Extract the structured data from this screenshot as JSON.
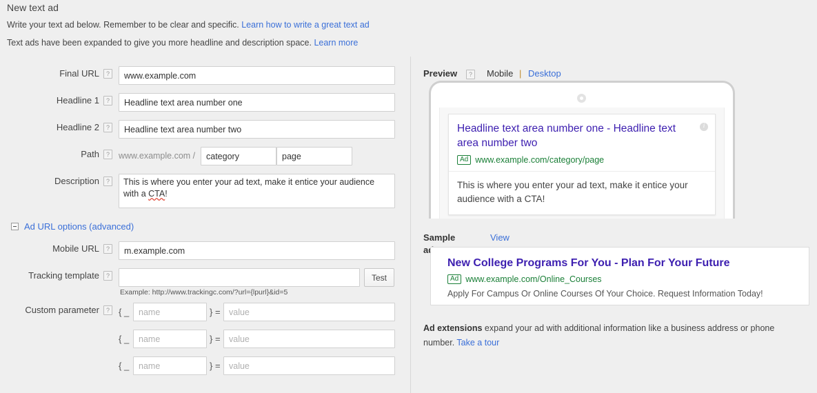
{
  "header": {
    "title": "New text ad",
    "line1_text": "Write your text ad below. Remember to be clear and specific.",
    "line1_link": "Learn how to write a great text ad",
    "line2_text": "Text ads have been expanded to give you more headline and description space.",
    "line2_link": "Learn more"
  },
  "form": {
    "final_url": {
      "label": "Final URL",
      "value": "www.example.com",
      "help": "?"
    },
    "headline1": {
      "label": "Headline 1",
      "value": "Headline text area number one",
      "help": "?"
    },
    "headline2": {
      "label": "Headline 2",
      "value": "Headline text area number two",
      "help": "?"
    },
    "path": {
      "label": "Path",
      "help": "?",
      "prefix": "www.example.com /",
      "separator": "/",
      "value1": "category",
      "value2": "page"
    },
    "description": {
      "label": "Description",
      "help": "?",
      "value": "This is where you enter your ad text, make it entice your audience with a CTA!",
      "plain": "This is where you enter your ad text, make it entice your audience with a ",
      "misspelled": "CTA"
    },
    "ad_url_options": {
      "label": "Ad URL options (advanced)",
      "icon": "minus-box-icon",
      "expanded": true
    },
    "mobile_url": {
      "label": "Mobile URL",
      "value": "m.example.com",
      "help": "?"
    },
    "tracking_template": {
      "label": "Tracking template",
      "help": "?",
      "value": "",
      "placeholder": "",
      "test_button": "Test",
      "hint": "Example: http://www.trackingc.com/?url={lpurl}&id=5"
    },
    "custom_parameter": {
      "label": "Custom parameter",
      "help": "?",
      "open_brace": "{ _",
      "close_brace": "} =",
      "rows": [
        {
          "name_placeholder": "name",
          "name_value": "",
          "value_placeholder": "value",
          "value_value": ""
        },
        {
          "name_placeholder": "name",
          "name_value": "",
          "value_placeholder": "value",
          "value_value": ""
        },
        {
          "name_placeholder": "name",
          "name_value": "",
          "value_placeholder": "value",
          "value_value": ""
        }
      ]
    }
  },
  "preview": {
    "label": "Preview",
    "help": "?",
    "tab_mobile": "Mobile",
    "tab_separator": "|",
    "tab_desktop": "Desktop",
    "active_tab": "Mobile",
    "ad": {
      "title": "Headline text area number one - Headline text area number two",
      "ad_badge": "Ad",
      "url": "www.example.com/category/page",
      "description": "This is where you enter your ad text, make it entice your audience with a CTA!",
      "info_icon": "info-icon"
    }
  },
  "sample_ads": {
    "label": "Sample ads",
    "view_more": "View more",
    "ad": {
      "title": "New College Programs For You - Plan For Your Future",
      "ad_badge": "Ad",
      "url": "www.example.com/Online_Courses",
      "description": "Apply For Campus Or Online Courses Of Your Choice. Request Information Today!"
    }
  },
  "ad_extensions": {
    "bold_lead": "Ad extensions",
    "text": " expand your ad with additional information like a business address or phone number. ",
    "link": "Take a tour"
  },
  "colors": {
    "page_bg": "#efefef",
    "link_blue": "#3a6fd8",
    "ad_title_purple": "#3d1fb0",
    "ad_green": "#1a7f37",
    "spell_red": "#e04b3a"
  }
}
